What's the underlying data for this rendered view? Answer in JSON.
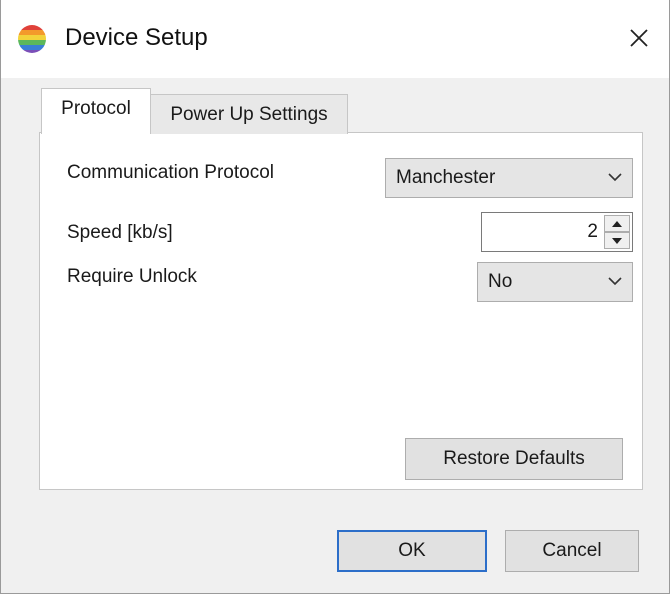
{
  "window": {
    "title": "Device Setup"
  },
  "icons": {
    "app": "app-color-ball-icon",
    "close": "close-icon",
    "chevron": "chevron-down-icon",
    "up": "arrow-up-icon",
    "down": "arrow-down-icon"
  },
  "tabs": [
    {
      "label": "Protocol",
      "active": true
    },
    {
      "label": "Power Up Settings",
      "active": false
    }
  ],
  "form": {
    "protocol": {
      "label": "Communication Protocol",
      "value": "Manchester"
    },
    "speed": {
      "label": "Speed [kb/s]",
      "value": "2"
    },
    "unlock": {
      "label": "Require Unlock",
      "value": "No"
    }
  },
  "buttons": {
    "restore": "Restore Defaults",
    "ok": "OK",
    "cancel": "Cancel"
  },
  "colors": {
    "focus_border": "#2c6ec9",
    "button_face": "#e1e1e1",
    "window_bg": "#f0f0f0"
  }
}
